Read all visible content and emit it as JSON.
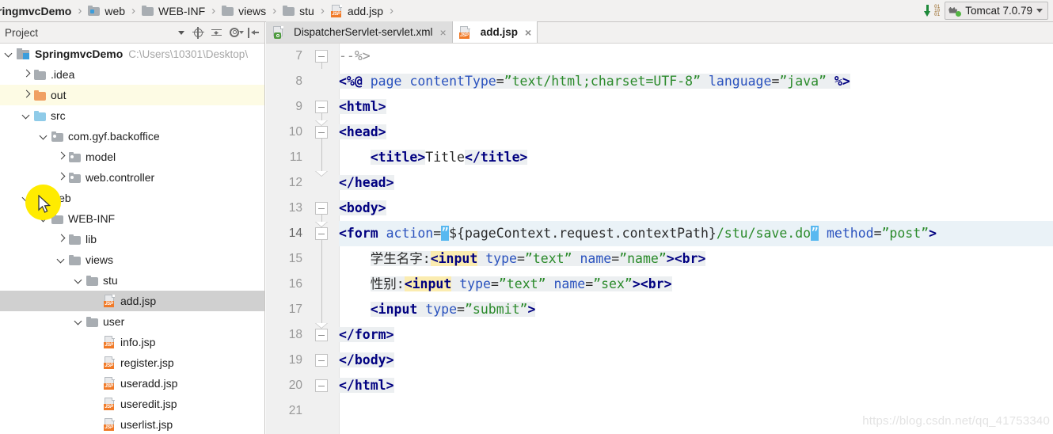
{
  "navbar": {
    "breadcrumbs": [
      {
        "label": "ringmvcDemo",
        "icon": "none"
      },
      {
        "label": "web",
        "icon": "folder-blue"
      },
      {
        "label": "WEB-INF",
        "icon": "folder-grey"
      },
      {
        "label": "views",
        "icon": "folder-grey"
      },
      {
        "label": "stu",
        "icon": "folder-grey"
      },
      {
        "label": "add.jsp",
        "icon": "jsp-file"
      }
    ],
    "separator": "›",
    "update_icon": "download-update-icon",
    "run_config": "Tomcat 7.0.79",
    "run_config_icon": "tomcat-cat-icon",
    "run_config_caret": "chevron-down-icon"
  },
  "sidebar": {
    "title": "Project",
    "title_caret": "chevron-down-icon",
    "tools": [
      {
        "name": "locate-in-tree-icon",
        "tip": "Select Opened File"
      },
      {
        "name": "collapse-all-icon",
        "tip": "Collapse All"
      },
      {
        "name": "gear-icon",
        "tip": "Settings"
      },
      {
        "name": "hide-panel-icon",
        "tip": "Hide"
      }
    ],
    "tree": [
      {
        "label": "SpringmvcDemo",
        "path": "C:\\Users\\10301\\Desktop\\",
        "indent": 0,
        "twisty": "down",
        "icon": "project-module-icon",
        "state": "root"
      },
      {
        "label": ".idea",
        "path": "",
        "indent": 1,
        "twisty": "right",
        "icon": "folder-grey",
        "state": "normal"
      },
      {
        "label": "out",
        "path": "",
        "indent": 1,
        "twisty": "right",
        "icon": "folder-orange",
        "state": "highlight"
      },
      {
        "label": "src",
        "path": "",
        "indent": 1,
        "twisty": "down",
        "icon": "folder-lightblue",
        "state": "normal"
      },
      {
        "label": "com.gyf.backoffice",
        "path": "",
        "indent": 2,
        "twisty": "down",
        "icon": "package-icon",
        "state": "normal"
      },
      {
        "label": "model",
        "path": "",
        "indent": 3,
        "twisty": "right",
        "icon": "package-icon",
        "state": "normal"
      },
      {
        "label": "web.controller",
        "path": "",
        "indent": 3,
        "twisty": "right",
        "icon": "package-icon",
        "state": "normal"
      },
      {
        "label": "web",
        "path": "",
        "indent": 1,
        "twisty": "down",
        "icon": "folder-blue",
        "state": "normal"
      },
      {
        "label": "WEB-INF",
        "path": "",
        "indent": 2,
        "twisty": "down",
        "icon": "folder-grey",
        "state": "normal"
      },
      {
        "label": "lib",
        "path": "",
        "indent": 3,
        "twisty": "right",
        "icon": "folder-grey",
        "state": "normal"
      },
      {
        "label": "views",
        "path": "",
        "indent": 3,
        "twisty": "down",
        "icon": "folder-grey",
        "state": "normal"
      },
      {
        "label": "stu",
        "path": "",
        "indent": 4,
        "twisty": "down",
        "icon": "folder-grey",
        "state": "normal"
      },
      {
        "label": "add.jsp",
        "path": "",
        "indent": 5,
        "twisty": "none",
        "icon": "jsp-file",
        "state": "selected"
      },
      {
        "label": "user",
        "path": "",
        "indent": 4,
        "twisty": "down",
        "icon": "folder-grey",
        "state": "normal"
      },
      {
        "label": "info.jsp",
        "path": "",
        "indent": 5,
        "twisty": "none",
        "icon": "jsp-file",
        "state": "normal"
      },
      {
        "label": "register.jsp",
        "path": "",
        "indent": 5,
        "twisty": "none",
        "icon": "jsp-file",
        "state": "normal"
      },
      {
        "label": "useradd.jsp",
        "path": "",
        "indent": 5,
        "twisty": "none",
        "icon": "jsp-file",
        "state": "normal"
      },
      {
        "label": "useredit.jsp",
        "path": "",
        "indent": 5,
        "twisty": "none",
        "icon": "jsp-file",
        "state": "normal"
      },
      {
        "label": "userlist.jsp",
        "path": "",
        "indent": 5,
        "twisty": "none",
        "icon": "jsp-file",
        "state": "normal"
      }
    ]
  },
  "editor": {
    "tabs": [
      {
        "label": "DispatcherServlet-servlet.xml",
        "icon": "xml-file",
        "active": false,
        "close": "×"
      },
      {
        "label": "add.jsp",
        "icon": "jsp-file",
        "active": true,
        "close": "×"
      }
    ],
    "current_line": 14,
    "lines": [
      {
        "num": "7",
        "text": "--%>"
      },
      {
        "num": "8",
        "text": "<%@ page contentType=\"text/html;charset=UTF-8\" language=\"java\" %>"
      },
      {
        "num": "9",
        "text": "<html>"
      },
      {
        "num": "10",
        "text": "<head>"
      },
      {
        "num": "11",
        "text": "    <title>Title</title>"
      },
      {
        "num": "12",
        "text": "</head>"
      },
      {
        "num": "13",
        "text": "<body>"
      },
      {
        "num": "14",
        "text": "<form action=\"${pageContext.request.contextPath}/stu/save.do\" method=\"post\">"
      },
      {
        "num": "15",
        "text": "    学生名字:<input type=\"text\" name=\"name\"><br>"
      },
      {
        "num": "16",
        "text": "    性别:<input type=\"text\" name=\"sex\"><br>"
      },
      {
        "num": "17",
        "text": "    <input type=\"submit\">"
      },
      {
        "num": "18",
        "text": "</form>"
      },
      {
        "num": "19",
        "text": "</body>"
      },
      {
        "num": "20",
        "text": "</html>"
      },
      {
        "num": "21",
        "text": ""
      }
    ]
  },
  "watermark": "https://blog.csdn.net/qq_41753340"
}
